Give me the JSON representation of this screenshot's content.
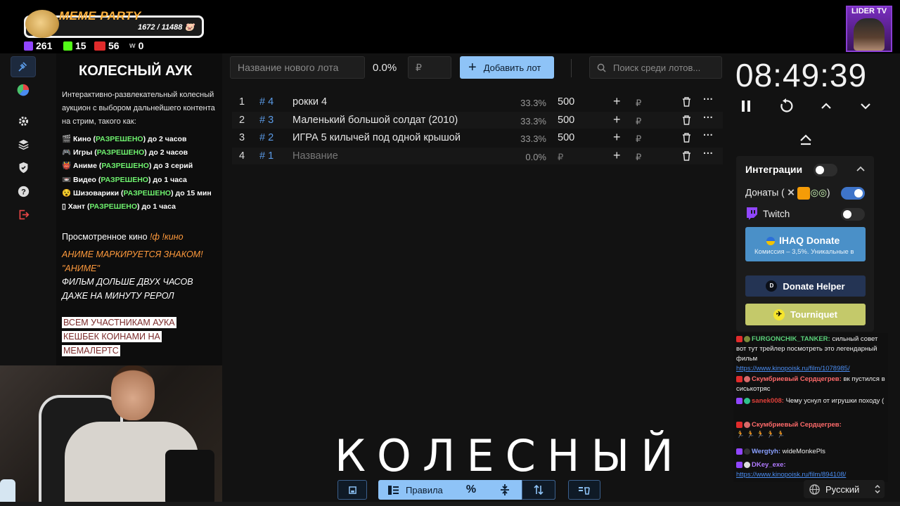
{
  "overlay": {
    "meme_title": "MEME PARTY",
    "meme_count": "1672 / 11488",
    "stats": [
      {
        "icon": "twitch-icon",
        "value": "261",
        "color": "#9146ff"
      },
      {
        "icon": "kick-icon",
        "value": "15",
        "color": "#53fc18"
      },
      {
        "icon": "live-icon",
        "value": "56",
        "color": "#e02b2b"
      },
      {
        "icon": "w-icon",
        "value": "0",
        "color": "#bbbbbb"
      }
    ],
    "lider_title": "LIDER TV"
  },
  "rules": {
    "title": "КОЛЕСНЫЙ АУК",
    "description": "Интерактивно-развлекательный колесный аукцион с выбором дальнейшего контента на стрим, такого как:",
    "items": [
      {
        "emoji": "🎬",
        "name": "Кино",
        "allowed": "РАЗРЕШЕНО",
        "limit": "до 2 часов"
      },
      {
        "emoji": "🎮",
        "name": "Игры",
        "allowed": "РАЗРЕШЕНО",
        "limit": "до 2 часов"
      },
      {
        "emoji": "👹",
        "name": "Аниме",
        "allowed": "РАЗРЕШЕНО",
        "limit": "до 3 серий"
      },
      {
        "emoji": "📼",
        "name": "Видео",
        "allowed": "РАЗРЕШЕНО",
        "limit": "до 1 часа"
      },
      {
        "emoji": "😵",
        "name": "Шизоварики",
        "allowed": "РАЗРЕШЕНО",
        "limit": "до 15 мин"
      },
      {
        "emoji": "▯",
        "name": "Хант",
        "allowed": "РАЗРЕШЕНО",
        "limit": "до 1  часа"
      }
    ],
    "watched_label": "Просмотренное кино",
    "watched_cmd": "!ф !кино",
    "notice_orange_1": "АНИМЕ МАРКИРУЕТСЯ ЗНАКОМ!",
    "notice_orange_2": "\"АНИМЕ\"",
    "notice_white_1": "ФИЛЬМ ДОЛЬШЕ ДВУХ ЧАСОВ",
    "notice_white_2": "ДАЖЕ НА МИНУТУ РЕРОЛ",
    "cashback_1": "ВСЕМ УЧАСТНИКАМ АУКА",
    "cashback_2": "КЕШБЕК КОИНАМИ НА",
    "cashback_3": "МЕМАЛЕРТС"
  },
  "toolbar": {
    "new_lot_placeholder": "Название нового лота",
    "percent": "0.0%",
    "rub_placeholder": "₽",
    "add_label": "Добавить лот",
    "search_placeholder": "Поиск среди лотов..."
  },
  "lots": [
    {
      "idx": "1",
      "num": "# 4",
      "name": "рокки 4",
      "pct": "33.3%",
      "amount": "500",
      "rub": "₽",
      "empty": false
    },
    {
      "idx": "2",
      "num": "# 3",
      "name": "Маленький большой солдат (2010)",
      "pct": "33.3%",
      "amount": "500",
      "rub": "₽",
      "empty": false
    },
    {
      "idx": "3",
      "num": "# 2",
      "name": "ИГРА 5 килычей под одной крышой",
      "pct": "33.3%",
      "amount": "500",
      "rub": "₽",
      "empty": false
    },
    {
      "idx": "4",
      "num": "# 1",
      "name": "Название",
      "pct": "0.0%",
      "amount": "₽",
      "rub": "₽",
      "empty": true
    }
  ],
  "timer": "08:49:39",
  "integrations": {
    "title": "Интеграции",
    "donations_label": "Донаты (",
    "twitch_label": "Twitch",
    "ihaq_title": "IHAQ Donate",
    "ihaq_sub": "Комиссия – 3,5%. Уникальные в",
    "donate_helper": "Donate Helper",
    "tourniquet": "Tourniquet"
  },
  "chat": [
    {
      "user": "FURGONCHIK_TANKER:",
      "user_color": "#5ad17a",
      "text": "сильный совет вот тут трейлер посмотреть это легендарный фильм",
      "link": "https://www.kinopoisk.ru/film/1078985/"
    },
    {
      "user": "Скумбриевый Сердцегрев:",
      "user_color": "#ff6a6a",
      "text": "вк пустился в сиськотряс",
      "link": ""
    },
    {
      "user": "sanek008:",
      "user_color": "#e0403a",
      "text": "Чему уснул от игрушки походу (",
      "link": ""
    },
    {
      "user": "Скумбриевый Сердцегрев:",
      "user_color": "#ff6a6a",
      "text": "🏃 🏃 🏃 🏃 🏃",
      "link": ""
    },
    {
      "user": "Wergtyh:",
      "user_color": "#8aa0ff",
      "text": "wideMonkePls",
      "link": ""
    },
    {
      "user": "DKey_exe:",
      "user_color": "#b07aff",
      "text": "",
      "link": "https://www.kinopoisk.ru/film/894108/"
    }
  ],
  "big_title": "КОЛЕСНЫЙ",
  "bottom": {
    "rules_label": "Правила",
    "language": "Русский"
  }
}
